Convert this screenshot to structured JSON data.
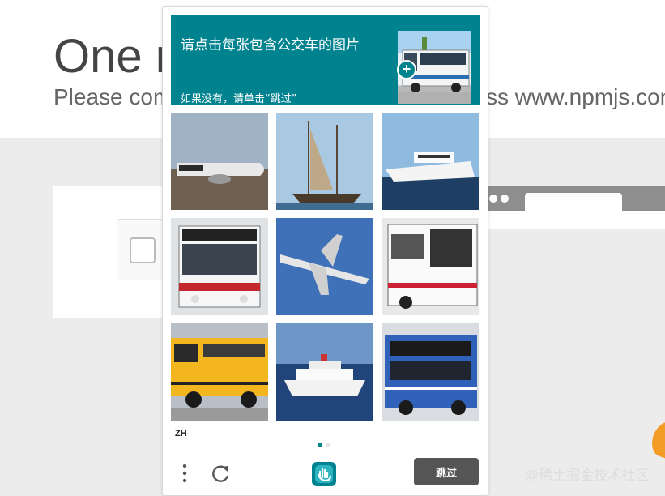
{
  "background": {
    "heading": "One r",
    "subtitle_left": "Please com",
    "subtitle_right": "ss www.npmjs.com"
  },
  "captcha": {
    "prompt_title": "请点击每张包含公交车的图片",
    "prompt_note": "如果没有，请单击“跳过”",
    "language": "ZH",
    "skip_label": "跳过",
    "accent_color": "#00838f",
    "tiles": [
      {
        "name": "tile-airplane-1"
      },
      {
        "name": "tile-sailboat"
      },
      {
        "name": "tile-yacht"
      },
      {
        "name": "tile-bus-1"
      },
      {
        "name": "tile-airplane-2"
      },
      {
        "name": "tile-bus-2"
      },
      {
        "name": "tile-school-bus"
      },
      {
        "name": "tile-cruise-ship"
      },
      {
        "name": "tile-bus-3"
      }
    ],
    "page_indicator": {
      "count": 2,
      "active": 0
    }
  },
  "watermark": "@稀土掘金技术社区"
}
